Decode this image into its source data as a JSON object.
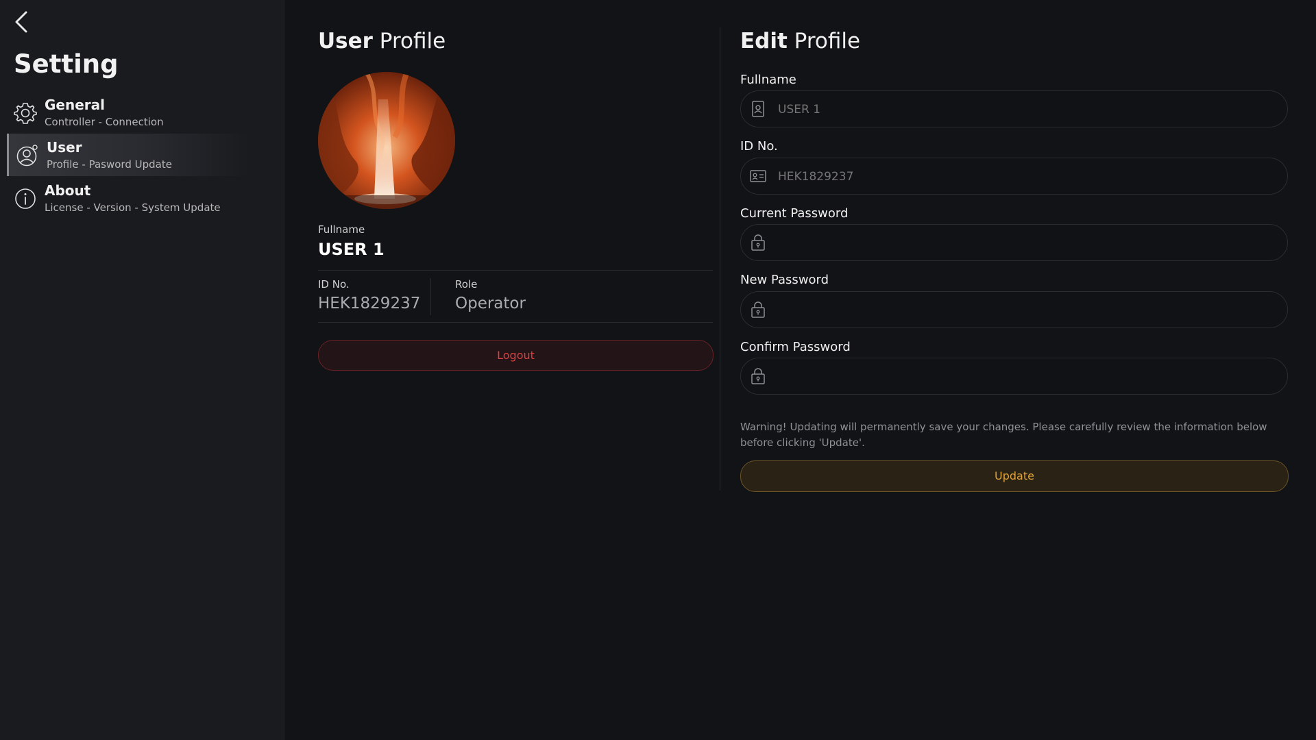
{
  "sidebar": {
    "title": "Setting",
    "items": [
      {
        "label": "General",
        "sub": "Controller - Connection"
      },
      {
        "label": "User",
        "sub": "Profile - Pasword Update"
      },
      {
        "label": "About",
        "sub": "License - Version - System Update"
      }
    ]
  },
  "profile": {
    "title_bold": "User",
    "title_light": "Profile",
    "fullname_label": "Fullname",
    "fullname": "USER 1",
    "id_label": "ID No.",
    "id": "HEK1829237",
    "role_label": "Role",
    "role": "Operator",
    "logout_label": "Logout"
  },
  "edit": {
    "title_bold": "Edit",
    "title_light": "Profile",
    "fields": [
      {
        "label": "Fullname",
        "placeholder": "USER 1",
        "value": ""
      },
      {
        "label": "ID No.",
        "placeholder": "HEK1829237",
        "value": ""
      },
      {
        "label": "Current Password",
        "placeholder": "",
        "value": ""
      },
      {
        "label": "New Password",
        "placeholder": "",
        "value": ""
      },
      {
        "label": "Confirm Password",
        "placeholder": "",
        "value": ""
      }
    ],
    "warning": "Warning! Updating will permanently save your changes. Please carefully review the information below before clicking 'Update'.",
    "update_label": "Update"
  },
  "colors": {
    "background": "#121316",
    "sidebar": "#1a1b1f",
    "logout_accent": "#e0413f",
    "update_accent": "#e0a23a"
  }
}
